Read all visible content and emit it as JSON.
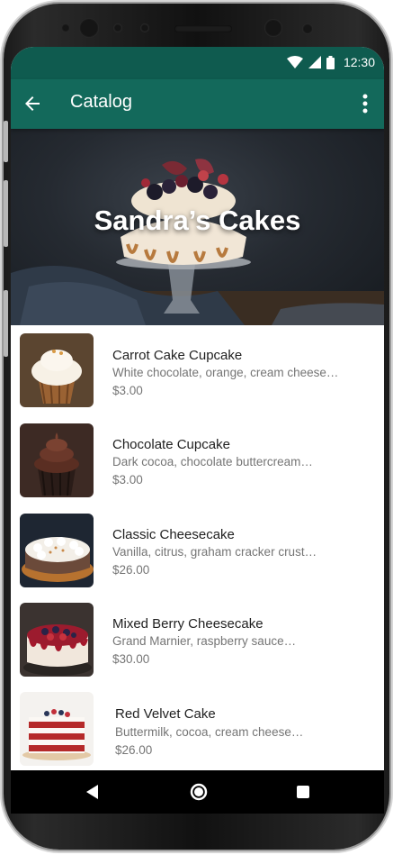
{
  "status": {
    "time": "12:30"
  },
  "appbar": {
    "title": "Catalog"
  },
  "hero": {
    "title": "Sandra’s Cakes"
  },
  "items": [
    {
      "name": "Carrot Cake Cupcake",
      "desc": "White chocolate, orange, cream cheese…",
      "price": "$3.00"
    },
    {
      "name": "Chocolate Cupcake",
      "desc": "Dark cocoa, chocolate buttercream…",
      "price": "$3.00"
    },
    {
      "name": "Classic Cheesecake",
      "desc": "Vanilla, citrus, graham cracker crust…",
      "price": "$26.00"
    },
    {
      "name": "Mixed Berry Cheesecake",
      "desc": "Grand Marnier, raspberry sauce…",
      "price": "$30.00"
    },
    {
      "name": "Red Velvet Cake",
      "desc": "Buttermilk, cocoa, cream cheese…",
      "price": "$26.00"
    }
  ],
  "colors": {
    "statusbar": "#0f5b4f",
    "appbar": "#13695b"
  },
  "icons": {
    "back": "arrow-back-icon",
    "menu": "more-vert-icon"
  }
}
